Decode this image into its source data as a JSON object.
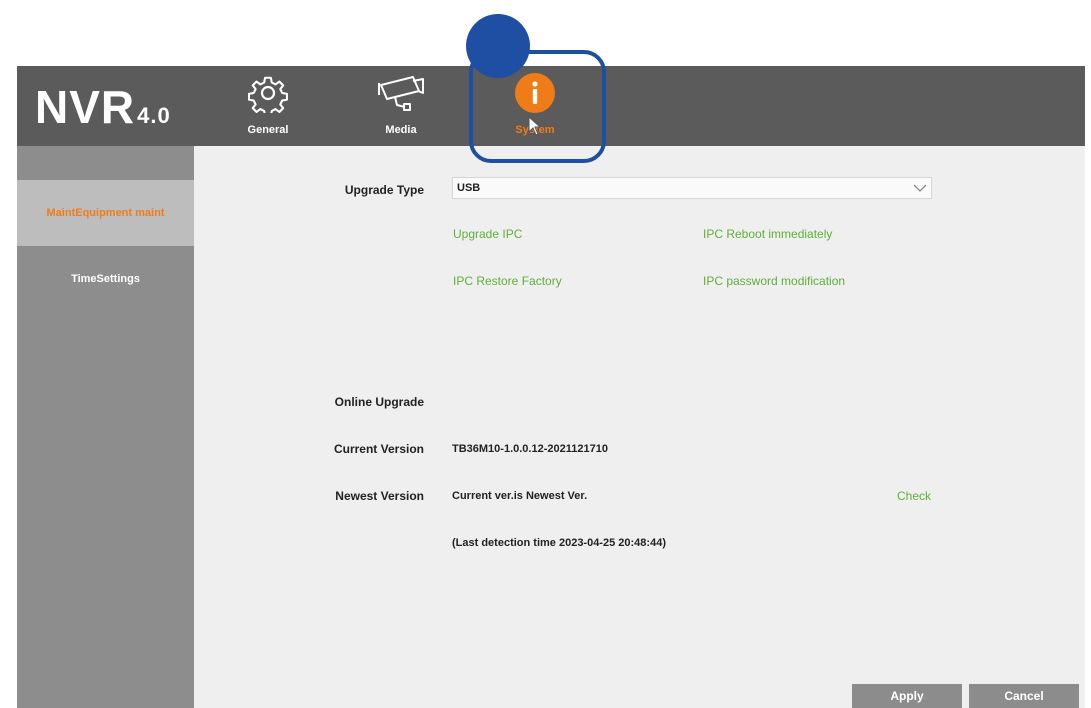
{
  "app": {
    "logo": "NVR",
    "version": "4.0"
  },
  "nav": [
    {
      "label": "General",
      "icon": "gear-icon"
    },
    {
      "label": "Media",
      "icon": "camera-icon"
    },
    {
      "label": "System",
      "icon": "info-icon",
      "active": true
    }
  ],
  "sidebar": {
    "items": [
      {
        "label": "MaintEquipment maint",
        "active": true
      },
      {
        "label": "TimeSettings"
      }
    ]
  },
  "form": {
    "upgrade_type_label": "Upgrade Type",
    "upgrade_type_value": "USB",
    "links": {
      "upgrade_ipc": "Upgrade IPC",
      "ipc_reboot": "IPC Reboot immediately",
      "ipc_restore": "IPC Restore Factory",
      "ipc_password": "IPC password modification"
    },
    "online_upgrade_label": "Online Upgrade",
    "current_version_label": "Current Version",
    "current_version_value": "TB36M10-1.0.0.12-2021121710",
    "newest_version_label": "Newest Version",
    "newest_version_value": "Current ver.is Newest Ver.",
    "check_label": "Check",
    "last_detection": "(Last detection time 2023-04-25 20:48:44)"
  },
  "buttons": {
    "apply": "Apply",
    "cancel": "Cancel"
  },
  "colors": {
    "accent_orange": "#f07c17",
    "link_green": "#5fae3b",
    "highlight_blue": "#1e4fa2",
    "topbar": "#5b5b5b",
    "sidebar": "#8d8d8d"
  }
}
